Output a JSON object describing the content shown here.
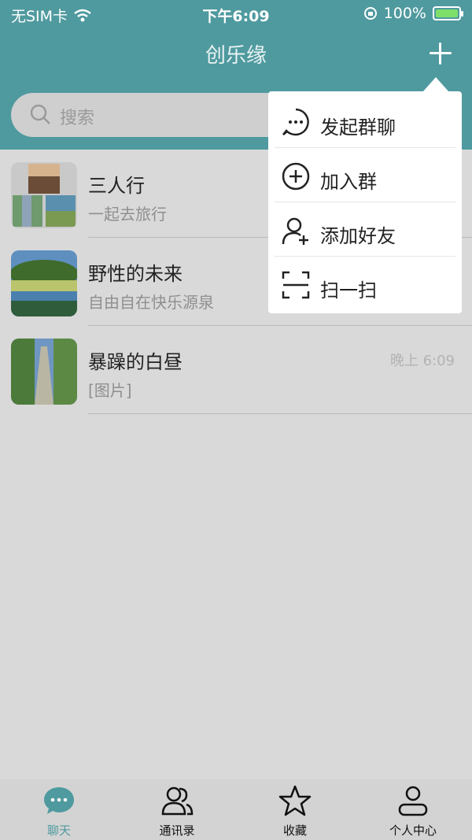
{
  "status_bar": {
    "carrier": "无SIM卡",
    "time": "下午6:09",
    "battery": "100%"
  },
  "header": {
    "title": "创乐缘"
  },
  "search": {
    "placeholder": "搜索"
  },
  "chats": [
    {
      "name": "三人行",
      "preview": "一起去旅行",
      "time": ""
    },
    {
      "name": "野性的未来",
      "preview": "自由自在快乐源泉",
      "time": ""
    },
    {
      "name": "暴躁的白昼",
      "preview": "[图片]",
      "time": "晚上 6:09"
    }
  ],
  "popup_menu": {
    "items": [
      {
        "label": "发起群聊",
        "icon": "chat-bubble-icon"
      },
      {
        "label": "加入群",
        "icon": "plus-circle-icon"
      },
      {
        "label": "添加好友",
        "icon": "add-user-icon"
      },
      {
        "label": "扫一扫",
        "icon": "scan-icon"
      }
    ]
  },
  "tabbar": {
    "tabs": [
      {
        "label": "聊天",
        "icon": "chat-icon",
        "active": true
      },
      {
        "label": "通讯录",
        "icon": "contacts-icon",
        "active": false
      },
      {
        "label": "收藏",
        "icon": "star-icon",
        "active": false
      },
      {
        "label": "个人中心",
        "icon": "profile-icon",
        "active": false
      }
    ]
  },
  "colors": {
    "accent": "#4f9a9f",
    "overlay_bg": "#d9d9d9"
  }
}
